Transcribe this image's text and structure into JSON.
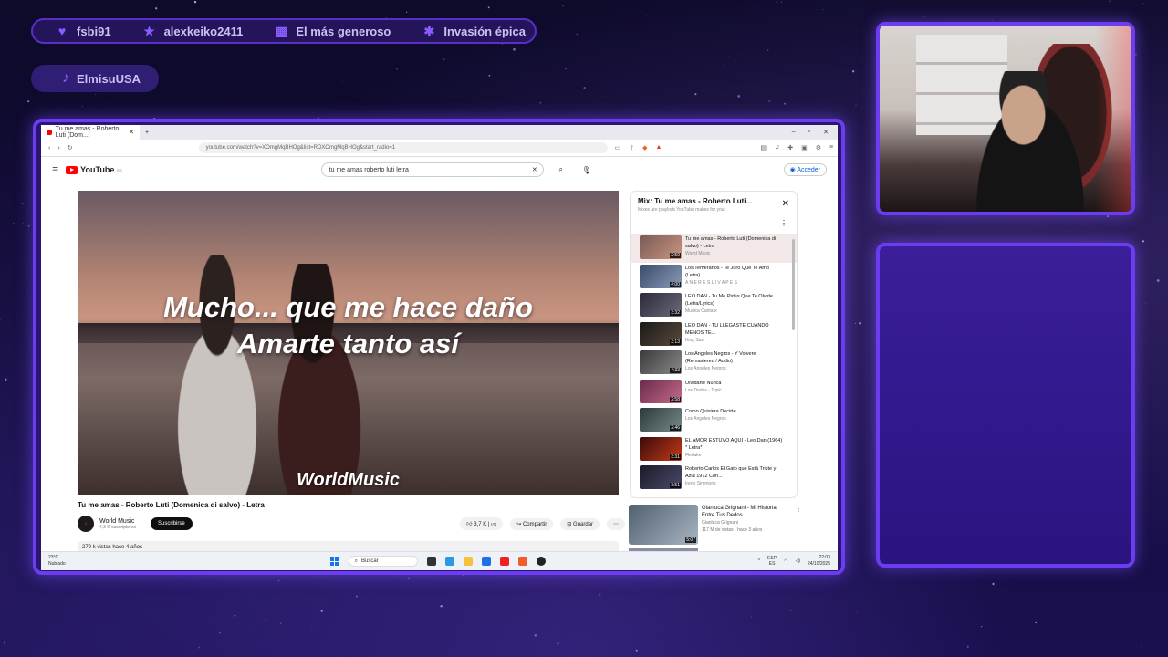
{
  "overlay": {
    "topbar": [
      {
        "label": "fsbi91",
        "icon": "heart-icon"
      },
      {
        "label": "alexkeiko2411",
        "icon": "star-icon"
      },
      {
        "label": "El más generoso",
        "icon": "gift-icon"
      },
      {
        "label": "Invasión épica",
        "icon": "paw-icon"
      }
    ],
    "tiktok_user": "ElmisuUSA"
  },
  "browser": {
    "tab_title": "Tu me amas - Roberto Luti (Dom...",
    "url": "youtube.com/watch?v=XOmgMqBHOg&list=RDXOmgMqBHOg&start_radio=1"
  },
  "youtube": {
    "logo": "YouTube",
    "country": "ES",
    "search_query": "tu me amas roberto luti letra",
    "signin": "Acceder",
    "video": {
      "lyric_line1": "Mucho... que me hace daño",
      "lyric_line2": "Amarte tanto así",
      "watermark": "WorldMusic",
      "title": "Tu me amas - Roberto Luti (Domenica di salvo) - Letra",
      "channel": "World Music",
      "subs": "4,3 K suscriptores",
      "subscribe": "Suscribirse",
      "likes": "3,7 K",
      "share": "Compartir",
      "save": "Guardar",
      "views": "279 k vistas  hace 4 años"
    },
    "mix": {
      "title": "Mix: Tu me amas - Roberto Luti...",
      "subtitle": "Mixes are playlists YouTube makes for you",
      "items": [
        {
          "title": "Tu me amas - Roberto Luti (Domenica di salvo) - Letra",
          "channel": "World Music",
          "duration": "2:50"
        },
        {
          "title": "Los Temerarios - Te Juro Que Te Amo (Letra)",
          "channel": "A N E R E S L I V A P E S",
          "duration": "4:00"
        },
        {
          "title": "LEO DAN - Tu Me Pides Que Te Olvide (Letra/Lyrics)",
          "channel": "Musica Cantaor",
          "duration": "3:32"
        },
        {
          "title": "LEO DAN - TU LLEGASTE CUANDO MENOS TE...",
          "channel": "King Sax",
          "duration": "3:13"
        },
        {
          "title": "Los Angeles Negros - Y Volvere (Remastered / Audio)",
          "channel": "Los Angeles Negros",
          "duration": "4:33"
        },
        {
          "title": "Olvidarte Nunca",
          "channel": "Los Dados - Topic",
          "duration": "2:58"
        },
        {
          "title": "Como Quisiera Decirte",
          "channel": "Los Angeles Negros",
          "duration": "2:46"
        },
        {
          "title": "EL AMOR ESTUVO AQUI - Leo Dan (1964) * Letra*",
          "channel": "Fleitake",
          "duration": "3:31"
        },
        {
          "title": "Roberto Carlos El Gato que Está Triste y Azul 1972 Con...",
          "channel": "Irene Simmons",
          "duration": "3:51"
        }
      ]
    },
    "recommended": {
      "title": "Gianluca Grignani - Mi Historia Entre Tus Dedos",
      "channel": "Gianluca Grignani",
      "meta": "117 M de vistas · hace 3 años",
      "duration": "5:07"
    }
  },
  "taskbar": {
    "weather_temp": "23°C",
    "weather_desc": "Nublado",
    "search": "Buscar",
    "lang": "ESP",
    "region": "ES",
    "time": "22:03",
    "date": "24/10/2025"
  }
}
